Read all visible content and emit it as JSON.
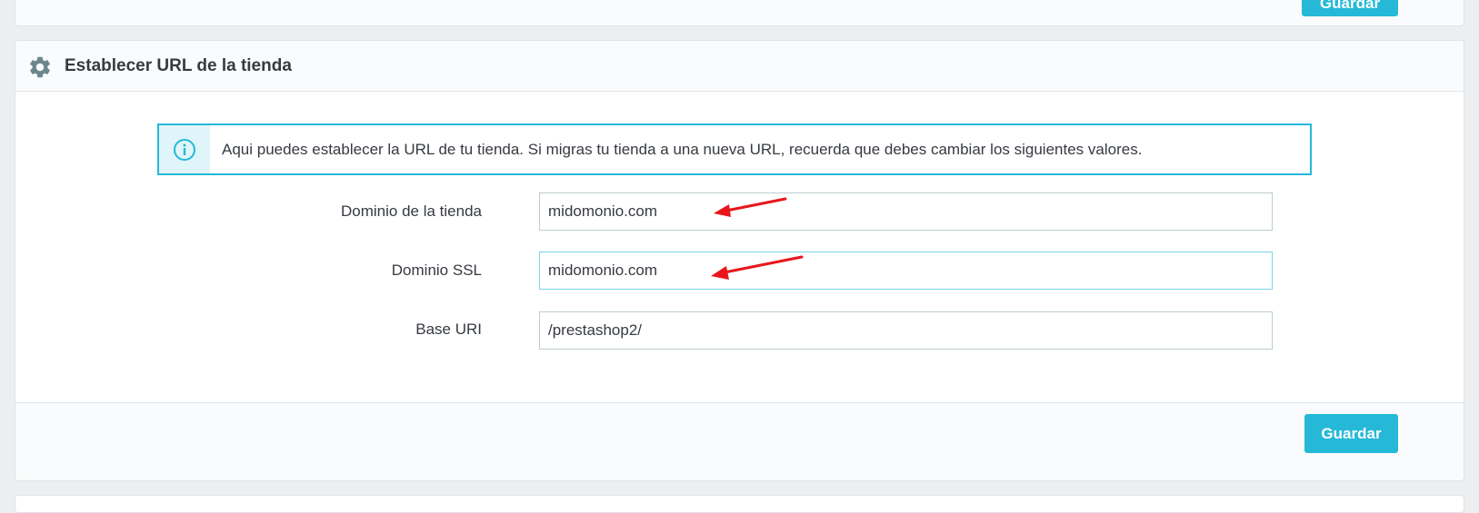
{
  "top_panel": {
    "save_label": "Guardar"
  },
  "shop_url_panel": {
    "title": "Establecer URL de la tienda",
    "title_icon": "gear-icon",
    "info_icon": "info-icon",
    "info_text": "Aqui puedes establecer la URL de tu tienda. Si migras tu tienda a una nueva URL, recuerda que debes cambiar los siguientes valores.",
    "fields": [
      {
        "label": "Dominio de la tienda",
        "value": "midomonio.com"
      },
      {
        "label": "Dominio SSL",
        "value": "midomonio.com"
      },
      {
        "label": "Base URI",
        "value": "/prestashop2/"
      }
    ],
    "save_label": "Guardar"
  },
  "colors": {
    "accent": "#25b9d7",
    "annotation_arrow": "#e8161b"
  }
}
